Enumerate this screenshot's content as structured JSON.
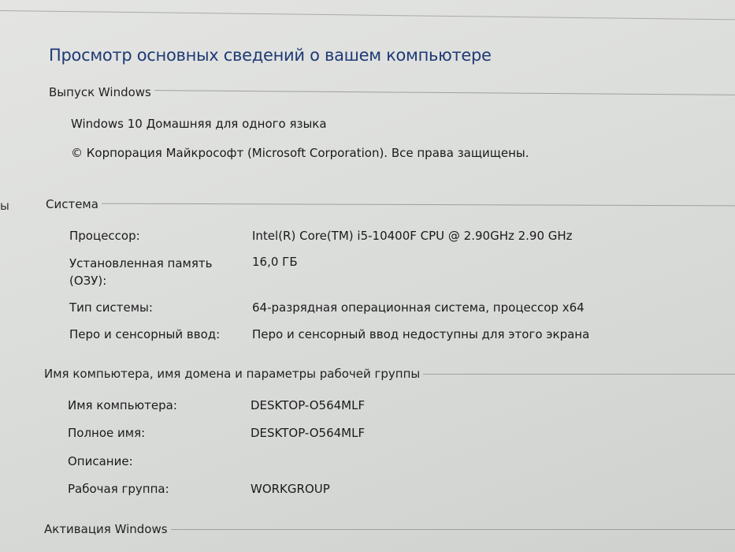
{
  "sidebar_fragment": "ы",
  "page_title": "Просмотр основных сведений о вашем компьютере",
  "edition": {
    "heading": "Выпуск Windows",
    "name": "Windows 10 Домашняя для одного языка",
    "copyright": "© Корпорация Майкрософт (Microsoft Corporation). Все права защищены."
  },
  "system": {
    "heading": "Система",
    "rows": [
      {
        "label": "Процессор:",
        "value": "Intel(R) Core(TM) i5-10400F CPU @ 2.90GHz   2.90 GHz"
      },
      {
        "label": "Установленная память (ОЗУ):",
        "value": "16,0 ГБ"
      },
      {
        "label": "Тип системы:",
        "value": "64-разрядная операционная система, процессор x64"
      },
      {
        "label": "Перо и сенсорный ввод:",
        "value": "Перо и сенсорный ввод недоступны для этого экрана"
      }
    ]
  },
  "computer": {
    "heading": "Имя компьютера, имя домена и параметры рабочей группы",
    "rows": [
      {
        "label": "Имя компьютера:",
        "value": "DESKTOP-O564MLF"
      },
      {
        "label": "Полное имя:",
        "value": "DESKTOP-O564MLF"
      },
      {
        "label": "Описание:",
        "value": ""
      },
      {
        "label": "Рабочая группа:",
        "value": "WORKGROUP"
      }
    ]
  },
  "activation": {
    "heading": "Активация Windows"
  }
}
